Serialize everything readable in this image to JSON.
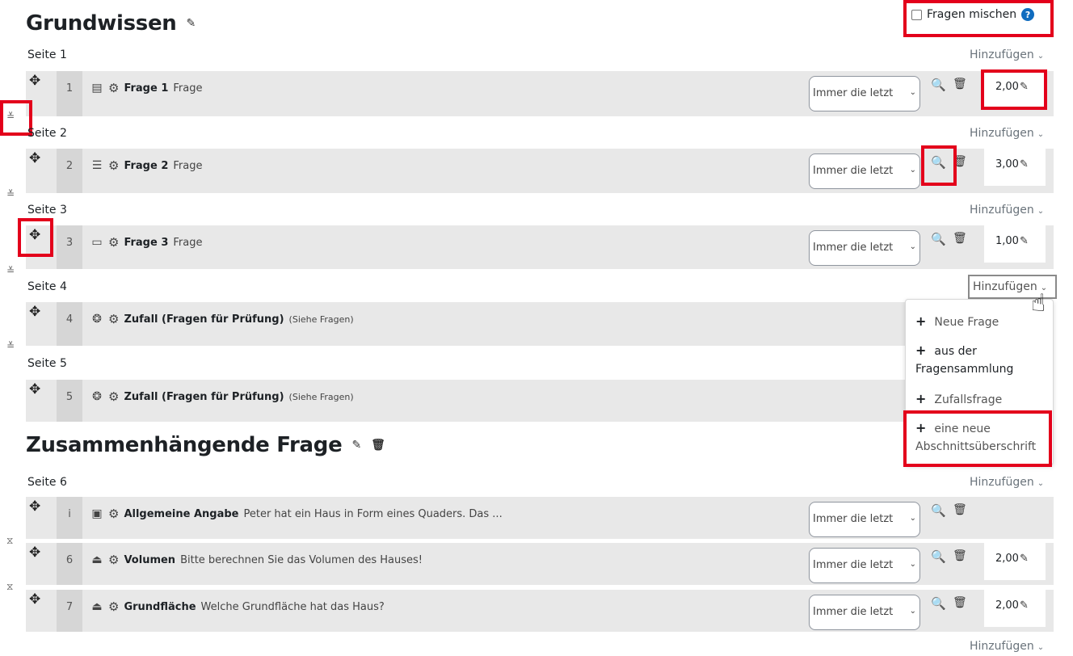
{
  "sections": [
    {
      "title": "Grundwissen"
    },
    {
      "title": "Zusammenhängende Frage"
    }
  ],
  "shuffle": {
    "label": "Fragen mischen",
    "help": "?"
  },
  "add_label": "Hinzufügen",
  "pages": [
    "Seite 1",
    "Seite 2",
    "Seite 3",
    "Seite 4",
    "Seite 5",
    "Seite 6"
  ],
  "select_value": "Immer die letzt",
  "questions": [
    {
      "num": "1",
      "icon": "essay-icon",
      "glyph": "▤",
      "name": "Frage 1",
      "text": "Frage",
      "mark": "2,00"
    },
    {
      "num": "2",
      "icon": "multichoice-icon",
      "glyph": "☰",
      "name": "Frage 2",
      "text": "Frage",
      "mark": "3,00"
    },
    {
      "num": "3",
      "icon": "shortanswer-icon",
      "glyph": "▭",
      "name": "Frage 3",
      "text": "Frage",
      "mark": "1,00"
    },
    {
      "num": "4",
      "icon": "random-icon",
      "glyph": "❂",
      "name": "Zufall (Fragen für Prüfung)",
      "text": "(Siehe Fragen)"
    },
    {
      "num": "5",
      "icon": "random-icon",
      "glyph": "❂",
      "name": "Zufall (Fragen für Prüfung)",
      "text": "(Siehe Fragen)"
    },
    {
      "num": "i",
      "icon": "description-icon",
      "glyph": "▣",
      "name": "Allgemeine Angabe",
      "text": "Peter hat ein Haus in Form eines Quaders. Das ..."
    },
    {
      "num": "6",
      "icon": "numerical-icon",
      "glyph": "⏏",
      "name": "Volumen",
      "text": "Bitte berechnen Sie das Volumen des Hauses!",
      "mark": "2,00"
    },
    {
      "num": "7",
      "icon": "numerical-icon",
      "glyph": "⏏",
      "name": "Grundfläche",
      "text": "Welche Grundfläche hat das Haus?",
      "mark": "2,00"
    }
  ],
  "add_menu": {
    "new_question": "Neue Frage",
    "from_bank_1": "aus der",
    "from_bank_2": "Fragensammlung",
    "random": "Zufallsfrage",
    "heading_1": "eine neue",
    "heading_2": "Abschnittsüberschrift"
  },
  "colors": {
    "highlight": "#e3001b",
    "help": "#0f6cbf",
    "row": "#e8e8e8"
  }
}
